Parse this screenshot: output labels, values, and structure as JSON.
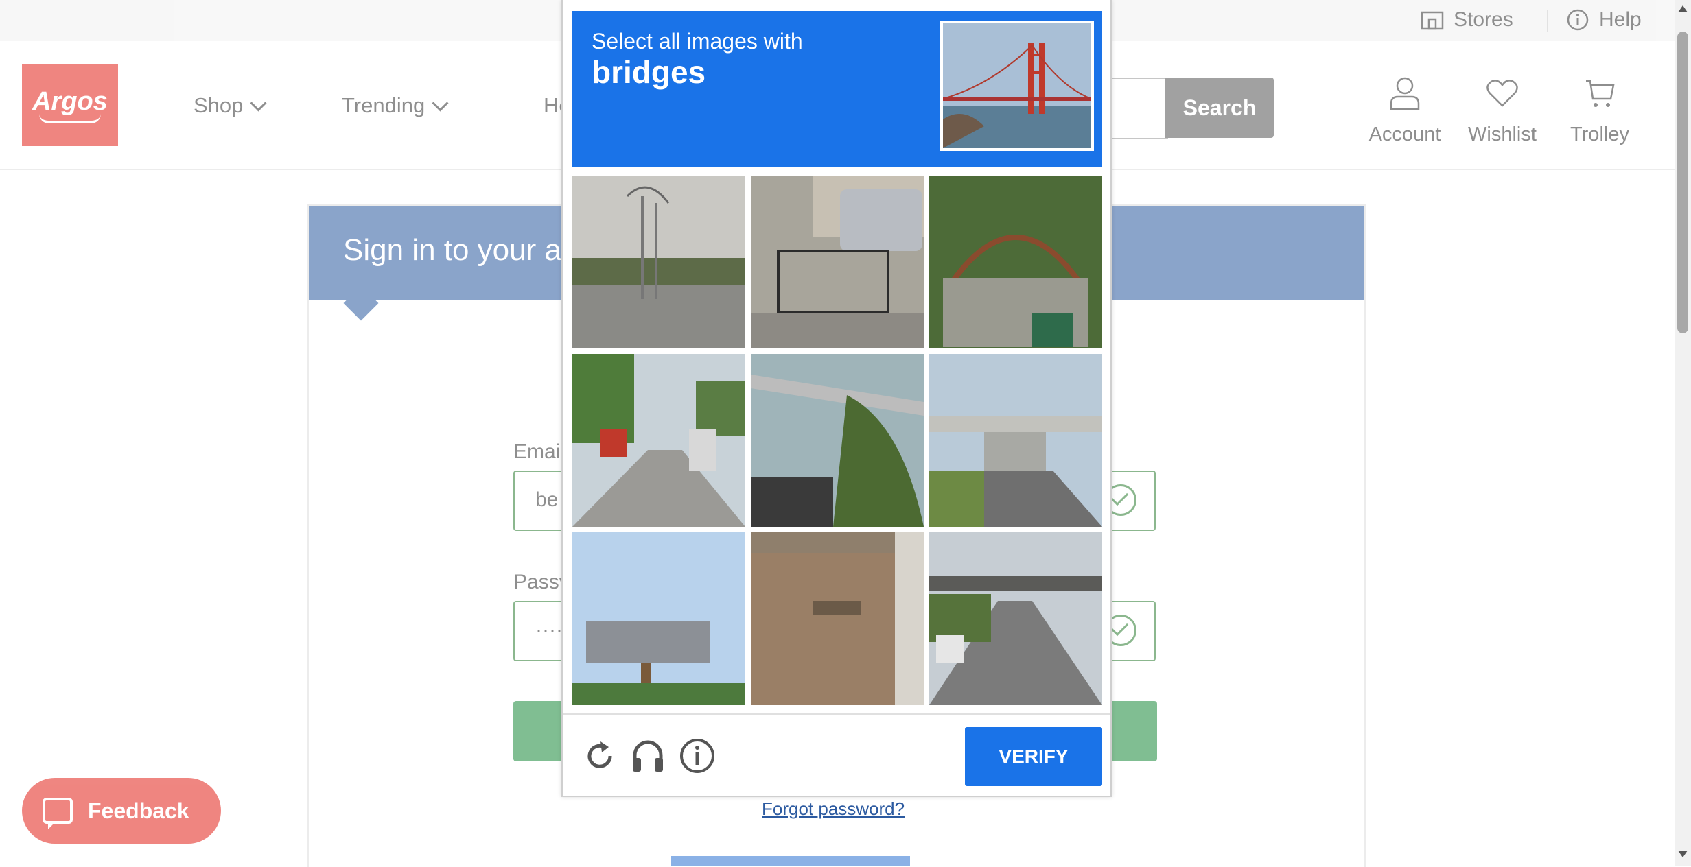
{
  "topbar": {
    "stores": "Stores",
    "help": "Help"
  },
  "header": {
    "logo": "Argos",
    "nav": [
      "Shop",
      "Trending",
      "He"
    ],
    "search_button": "Search",
    "account": "Account",
    "wishlist": "Wishlist",
    "trolley": "Trolley"
  },
  "signin": {
    "title": "Sign in to your accou",
    "email_label": "Emai",
    "email_value": "be",
    "password_label": "Passv",
    "password_value": "·····"
  },
  "feedback": "Feedback",
  "captcha": {
    "instruction": "Select all images with",
    "target": "bridges",
    "verify": "VERIFY",
    "tiles": [
      "street-lamps",
      "car-and-fence",
      "garden-gate",
      "busy-street",
      "overpass-bridge",
      "concrete-bridge",
      "billboard",
      "concrete-wall",
      "highway-bridge"
    ]
  },
  "forgot_password": "Forgot password?",
  "colors": {
    "argos_red": "#e2231a",
    "captcha_blue": "#1a73e8",
    "panel_blue": "#2c5aa0",
    "success_green": "#2e7d32"
  }
}
